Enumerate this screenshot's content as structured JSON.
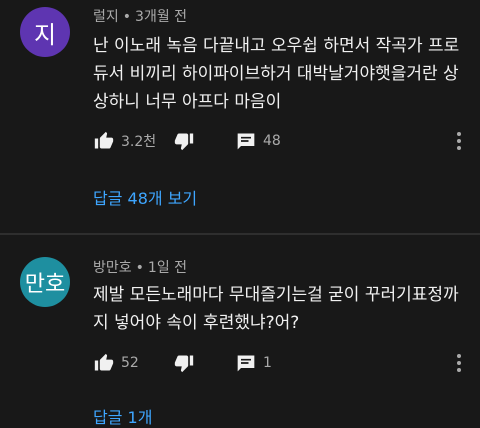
{
  "comments": [
    {
      "avatar_text": "지",
      "author": "럴지",
      "separator": "•",
      "time": "3개월 전",
      "text": "난 이노래 녹음 다끝내고 오우쉽 하면서 작곡가 프로듀서 비끼리 하이파이브하거 대박날거야햇을거란 상상하니 너무 아프다 마음이",
      "likes": "3.2천",
      "replies_count": "48",
      "replies_link": "답글 48개 보기"
    },
    {
      "avatar_text": "만호",
      "author": "방만호",
      "separator": "•",
      "time": "1일 전",
      "text": "제발 모든노래마다 무대즐기는걸 굳이 꾸러기표정까지 넣어야 속이 후련했냐?어?",
      "likes": "52",
      "replies_count": "1",
      "replies_link": "답글 1개"
    }
  ],
  "icons": {
    "like": "thumb-up-icon",
    "dislike": "thumb-down-icon",
    "reply": "comment-icon",
    "menu": "more-vert-icon"
  },
  "colors": {
    "background": "#181818",
    "link": "#3ea6ff",
    "avatar_1": "#5e35b1",
    "avatar_2": "#1e8fa0"
  }
}
